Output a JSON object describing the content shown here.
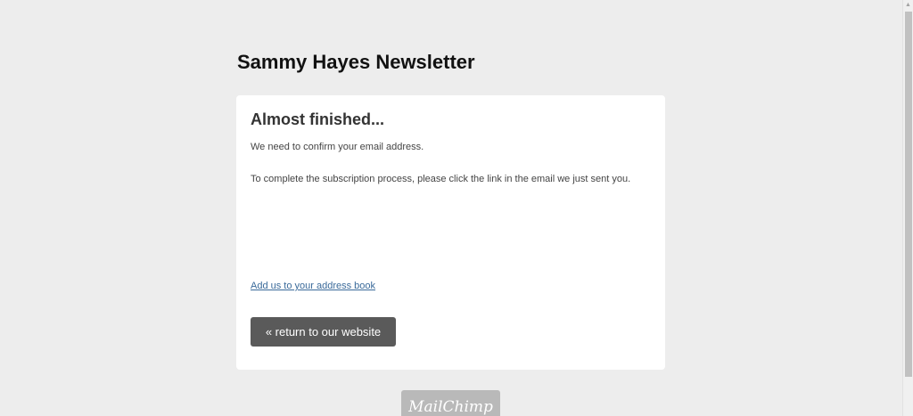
{
  "header": {
    "site_title": "Sammy Hayes Newsletter"
  },
  "card": {
    "heading": "Almost finished...",
    "text_confirm": "We need to confirm your email address.",
    "text_instructions": "To complete the subscription process, please click the link in the email we just sent you.",
    "address_book_link": "Add us to your address book",
    "return_button_label": "« return to our website"
  },
  "footer": {
    "badge_logo": "MailChimp"
  },
  "scrollbar": {
    "up_arrow": "▲"
  }
}
